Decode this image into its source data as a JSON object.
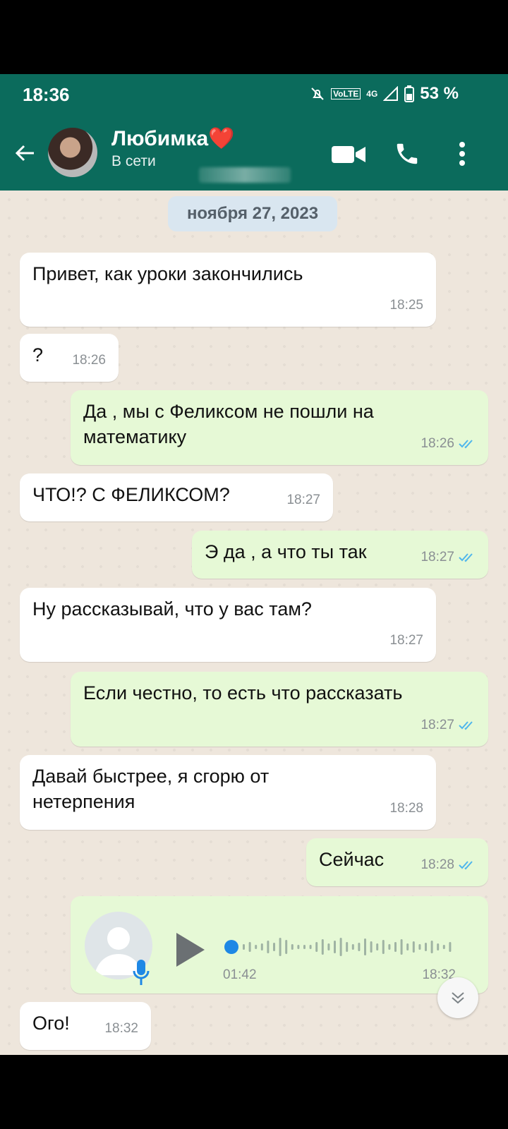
{
  "status_bar": {
    "time": "18:36",
    "network": "VoLTE",
    "signal": "4G",
    "battery": "53 %"
  },
  "header": {
    "contact_name": "Любимка❤️",
    "contact_status": "В сети"
  },
  "date_chip": "ноября 27, 2023",
  "messages": [
    {
      "dir": "in",
      "text": "Привет, как уроки закончились",
      "time": "18:25"
    },
    {
      "dir": "in",
      "text": "?",
      "time": "18:26"
    },
    {
      "dir": "out",
      "text": "Да , мы с Феликсом не пошли на математику",
      "time": "18:26"
    },
    {
      "dir": "in",
      "text": "ЧТО!? С ФЕЛИКСОМ?",
      "time": "18:27"
    },
    {
      "dir": "out",
      "text": "Э да , а что ты так",
      "time": "18:27"
    },
    {
      "dir": "in",
      "text": "Ну рассказывай, что у вас там?",
      "time": "18:27"
    },
    {
      "dir": "out",
      "text": "Если честно, то есть что рассказать",
      "time": "18:27"
    },
    {
      "dir": "in",
      "text": "Давай быстрее, я сгорю от нетерпения",
      "time": "18:28"
    },
    {
      "dir": "out",
      "text": "Сейчас",
      "time": "18:28"
    },
    {
      "dir": "out",
      "type": "voice",
      "duration": "01:42",
      "time": "18:32",
      "progress": 0.0
    },
    {
      "dir": "in",
      "text": "Ого!",
      "time": "18:32"
    }
  ],
  "colors": {
    "header": "#0b6b5c",
    "outgoing": "#e6f9d6",
    "incoming": "#ffffff",
    "read_ticks": "#4fb6ec"
  }
}
